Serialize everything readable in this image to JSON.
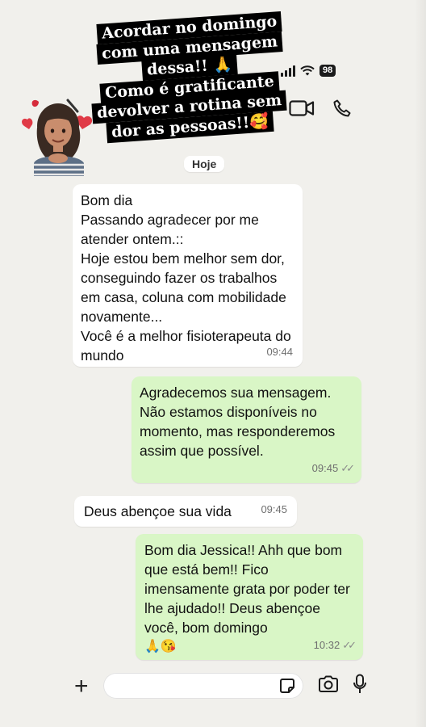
{
  "caption": {
    "lines": [
      "Acordar no domingo",
      "com uma mensagem",
      "dessa!! 🙏",
      "Como é gratificante",
      "devolver a rotina sem",
      "dor as pessoas!!🥰"
    ]
  },
  "status": {
    "battery": "98"
  },
  "chat": {
    "date_label": "Hoje",
    "messages": [
      {
        "direction": "in",
        "text": "Bom dia\nPassando agradecer por me atender ontem.::\nHoje estou bem melhor sem dor, conseguindo fazer os trabalhos em casa, coluna com mobilidade novamente...\nVocê é a melhor fisioterapeuta do mundo",
        "time": "09:44"
      },
      {
        "direction": "out",
        "text": "Agradecemos sua mensagem. Não estamos disponíveis no momento, mas responderemos assim que possível.",
        "time": "09:45",
        "status": "read"
      },
      {
        "direction": "in",
        "text": "Deus abençoe sua vida",
        "time": "09:45"
      },
      {
        "direction": "out",
        "text": "Bom dia Jessica!! Ahh que bom que está bem!! Fico imensamente grata por poder ter lhe ajudado!! Deus abençoe você, bom domingo",
        "emoji": "🙏😘",
        "time": "10:32",
        "status": "read"
      }
    ]
  },
  "icons": {
    "video": "video-call-icon",
    "phone": "phone-call-icon",
    "plus": "plus-icon",
    "sticker": "sticker-icon",
    "camera": "camera-icon",
    "mic": "microphone-icon"
  },
  "colors": {
    "background": "#f1f0ec",
    "incoming_bubble": "#ffffff",
    "outgoing_bubble": "#d9f6c6",
    "caption_background": "#000000"
  },
  "tick_glyph": "✓✓"
}
